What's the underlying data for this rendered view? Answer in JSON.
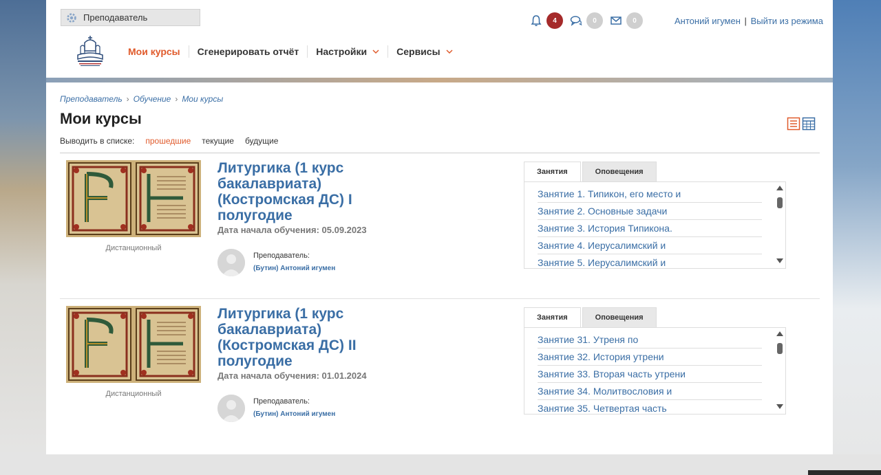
{
  "header": {
    "role": "Преподаватель",
    "nav": [
      {
        "label": "Мои курсы",
        "active": true,
        "dropdown": false
      },
      {
        "label": "Сгенерировать отчёт",
        "active": false,
        "dropdown": false
      },
      {
        "label": "Настройки",
        "active": false,
        "dropdown": true
      },
      {
        "label": "Сервисы",
        "active": false,
        "dropdown": true
      }
    ],
    "notifications": {
      "count": "4"
    },
    "messages": {
      "count": "0"
    },
    "mail": {
      "count": "0"
    },
    "user_name": "Антоний игумен",
    "separator": "|",
    "exit_link": "Выйти из режима"
  },
  "breadcrumb": [
    "Преподаватель",
    "Обучение",
    "Мои курсы"
  ],
  "breadcrumb_arrow": "›",
  "page_title": "Мои курсы",
  "filter": {
    "label": "Выводить в списке:",
    "options": [
      "прошедшие",
      "текущие",
      "будущие"
    ],
    "active": "прошедшие"
  },
  "courses": [
    {
      "title": "Литургика (1 курс бакалавриата) (Костромская ДС) I полугодие",
      "date": "Дата начала обучения: 05.09.2023",
      "mode": "Дистанционный",
      "teacher_label": "Преподаватель:",
      "teacher_name": "(Бутин) Антоний игумен",
      "tabs": [
        "Занятия",
        "Оповещения"
      ],
      "lessons": [
        "Занятие 1. Типикон, его место и",
        "Занятие 2. Основные задачи",
        "Занятие 3. История Типикона.",
        "Занятие 4. Иерусалимский и",
        "Занятие 5. Иерусалимский и"
      ]
    },
    {
      "title": "Литургика (1 курс бакалавриата) (Костромская ДС) II полугодие",
      "date": "Дата начала обучения: 01.01.2024",
      "mode": "Дистанционный",
      "teacher_label": "Преподаватель:",
      "teacher_name": "(Бутин) Антоний игумен",
      "tabs": [
        "Занятия",
        "Оповещения"
      ],
      "lessons": [
        "Занятие 31. Утреня по",
        "Занятие 32. История утрени",
        "Занятие 33. Вторая часть утрени",
        "Занятие 34. Молитвословия и",
        "Занятие 35. Четвертая часть"
      ]
    }
  ],
  "colors": {
    "accent": "#e05a2b",
    "link": "#3a6ea5",
    "badge_red": "#a52a2a"
  },
  "icons": [
    "gear-icon",
    "bell-icon",
    "chat-icon",
    "mail-icon",
    "list-view-icon",
    "table-view-icon",
    "chevron-down-icon"
  ]
}
